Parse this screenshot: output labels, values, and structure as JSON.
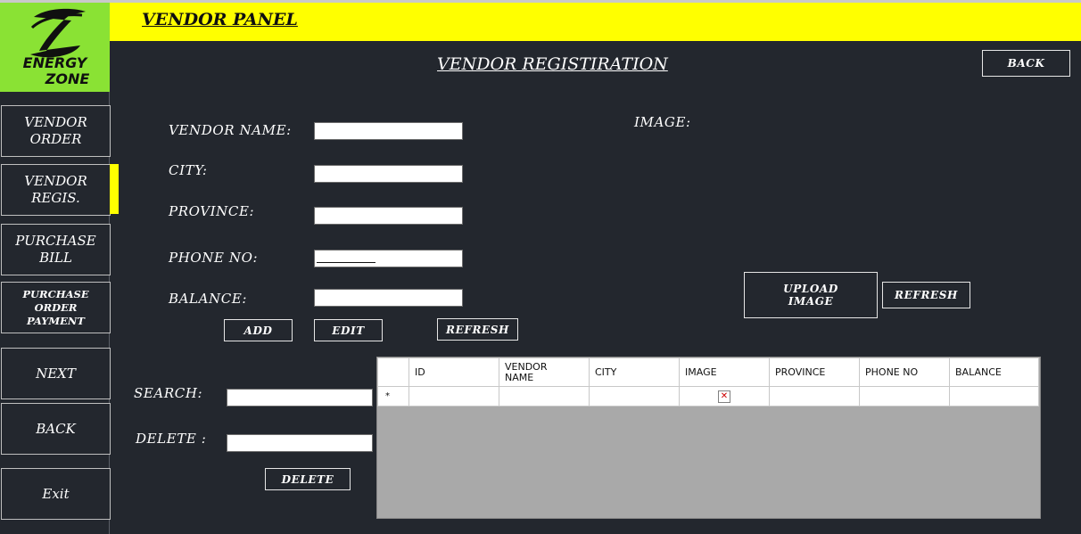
{
  "sidebar": {
    "logo": {
      "line1": "ENERGY",
      "line2": "ZONE"
    },
    "items": [
      {
        "label": "VENDOR ORDER"
      },
      {
        "label": "VENDOR REGIS."
      },
      {
        "label": "PURCHASE BILL"
      },
      {
        "label": "PURCHASE ORDER PAYMENT"
      },
      {
        "label": "NEXT"
      },
      {
        "label": "BACK"
      },
      {
        "label": "Exit"
      }
    ]
  },
  "header": {
    "title": "VENDOR PANEL"
  },
  "form": {
    "title": "VENDOR REGISTIRATION",
    "back_button": "BACK",
    "fields": [
      {
        "label": "VENDOR NAME:",
        "value": ""
      },
      {
        "label": "CITY:",
        "value": ""
      },
      {
        "label": "PROVINCE:",
        "value": ""
      },
      {
        "label": "PHONE NO:",
        "value": ""
      },
      {
        "label": "BALANCE:",
        "value": ""
      }
    ],
    "add_button": "ADD",
    "edit_button": "EDIT",
    "refresh_button": "REFRESH",
    "image_label": "IMAGE:",
    "upload_button": "UPLOAD IMAGE",
    "image_refresh_button": "REFRESH",
    "search_label": "SEARCH:",
    "delete_label": "DELETE :",
    "delete_button": "DELETE"
  },
  "grid": {
    "columns": [
      "ID",
      "VENDOR NAME",
      "CITY",
      "IMAGE",
      "PROVINCE",
      "PHONE NO",
      "BALANCE"
    ],
    "new_row_marker": "*"
  },
  "colors": {
    "background": "#23272e",
    "accent": "#ffff00",
    "logo_bg": "#8ae234",
    "grid_empty": "#a9a9a9"
  }
}
